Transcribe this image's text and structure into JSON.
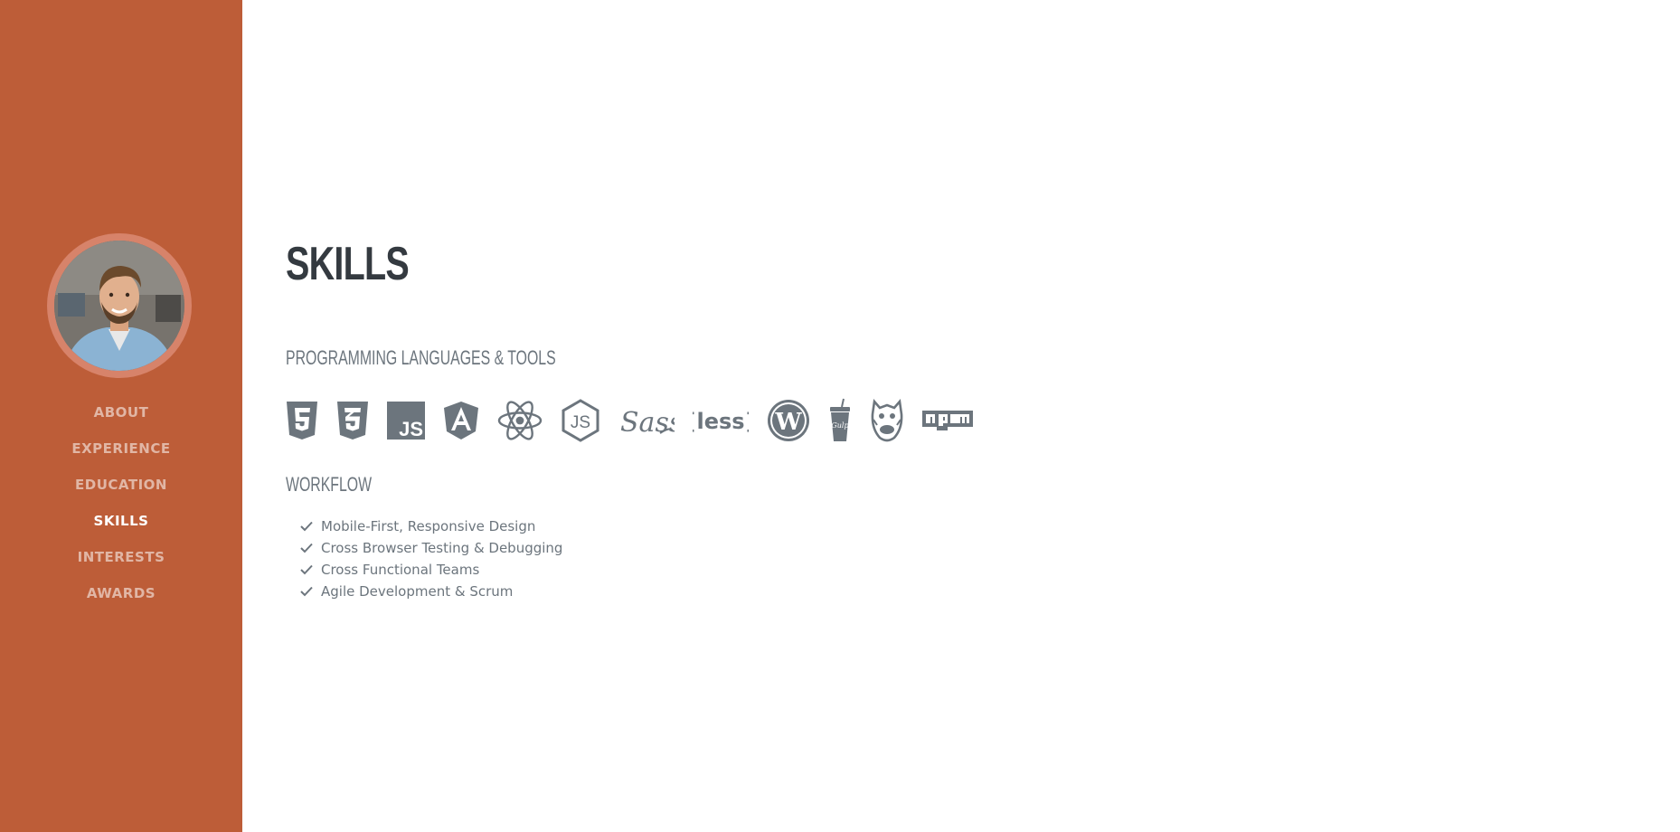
{
  "sidebar": {
    "profile_image": "profile-photo",
    "nav": [
      "ABOUT",
      "EXPERIENCE",
      "EDUCATION",
      "SKILLS",
      "INTERESTS",
      "AWARDS"
    ],
    "active_item": "SKILLS",
    "background_color": "#bd5d38"
  },
  "main": {
    "title": "SKILLS",
    "languages_heading": "PROGRAMMING LANGUAGES & TOOLS",
    "tool_icons": [
      "html5-icon",
      "css3-icon",
      "javascript-icon",
      "angular-icon",
      "react-icon",
      "nodejs-icon",
      "sass-icon",
      "less-icon",
      "wordpress-icon",
      "gulp-icon",
      "grunt-icon",
      "npm-icon"
    ],
    "workflow_heading": "WORKFLOW",
    "workflow_items": [
      "Mobile-First, Responsive Design",
      "Cross Browser Testing & Debugging",
      "Cross Functional Teams",
      "Agile Development & Scrum"
    ],
    "text_color": "#6c757d",
    "heading_color": "#343a40"
  }
}
